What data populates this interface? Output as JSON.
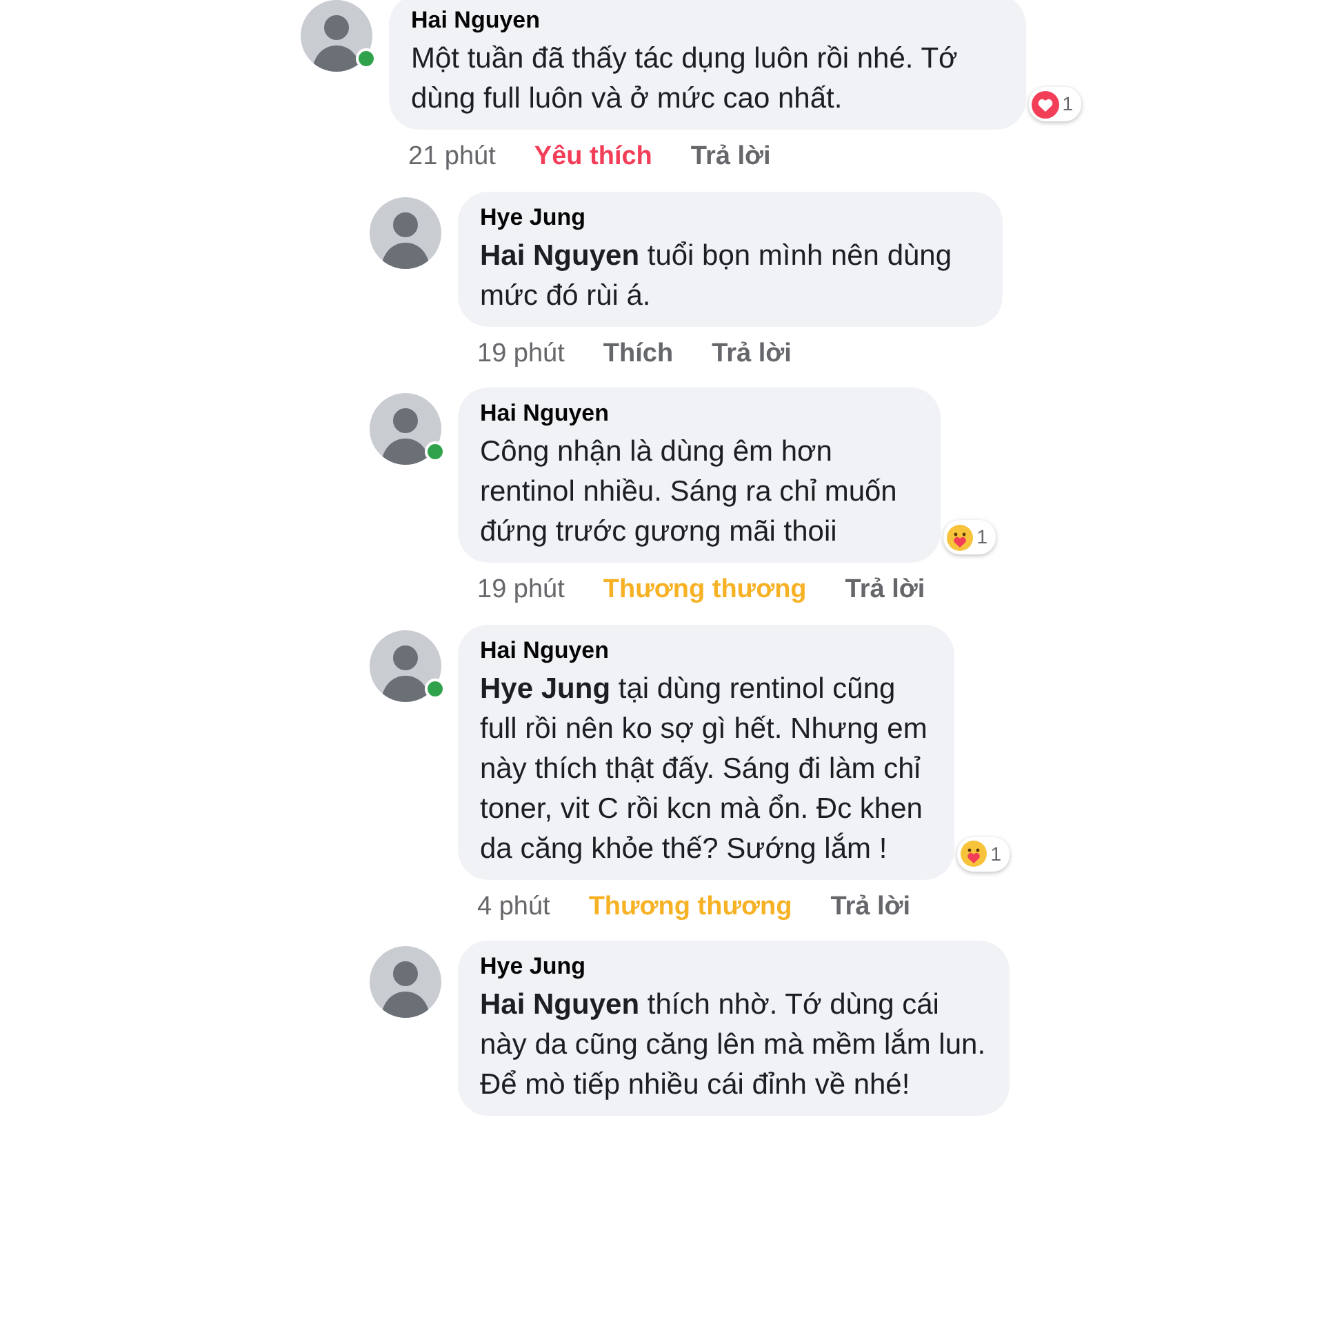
{
  "comments": [
    {
      "author": "Hai Nguyen",
      "nested": false,
      "online": true,
      "text": "Một tuần đã thấy tác dụng luôn rồi nhé. Tớ dùng full luôn và ở mức cao nhất.",
      "time": "21 phút",
      "reaction_label": "Yêu thích",
      "color": "#f33e58",
      "reply_label": "Trả lời",
      "badge": {
        "kind": "love",
        "count": "1"
      }
    },
    {
      "author": "Hye Jung",
      "nested": true,
      "online": false,
      "text": "**Hai Nguyen** tuổi bọn mình nên dùng mức đó rùi á.",
      "time": "19 phút",
      "reaction_label": "Thích",
      "color": "#65676b",
      "reply_label": "Trả lời"
    },
    {
      "author": "Hai Nguyen",
      "nested": true,
      "online": true,
      "text": "Công nhận là dùng êm hơn rentinol nhiều. Sáng ra chỉ muốn đứng trước gương mãi thoii",
      "time": "19 phút",
      "reaction_label": "Thương thương",
      "color": "#f7b125",
      "reply_label": "Trả lời",
      "badge": {
        "kind": "care",
        "count": "1"
      }
    },
    {
      "author": "Hai Nguyen",
      "nested": true,
      "online": true,
      "text": "**Hye Jung**  tại dùng rentinol cũng full rồi nên ko sợ gì hết. Nhưng em này thích thật đấy. Sáng đi làm chỉ toner, vit C rồi kcn mà ổn. Đc khen da căng khỏe thế? Sướng lắm !",
      "time": "4 phút",
      "reaction_label": "Thương thương",
      "color": "#f7b125",
      "reply_label": "Trả lời",
      "badge": {
        "kind": "care",
        "count": "1"
      }
    },
    {
      "author": "Hye Jung",
      "nested": true,
      "online": false,
      "text": "**Hai Nguyen** thích nhờ. Tớ dùng cái này da cũng căng lên mà mềm lắm lun. Để mò tiếp nhiều cái đỉnh về nhé!"
    }
  ]
}
